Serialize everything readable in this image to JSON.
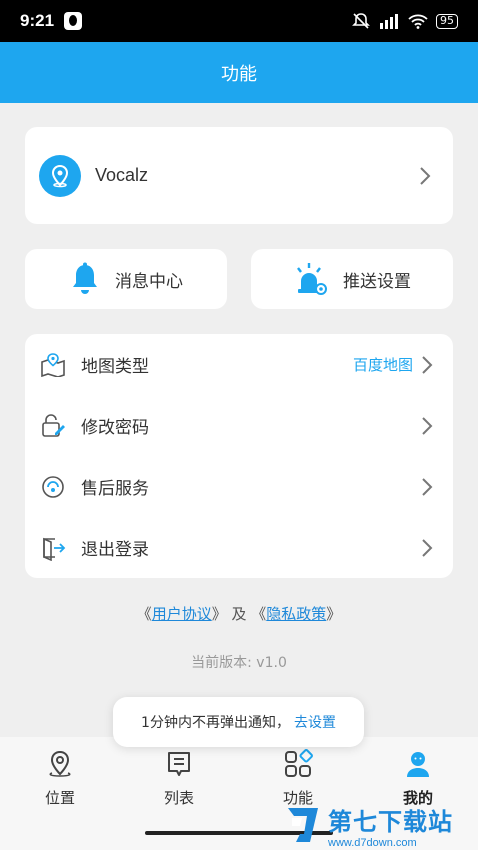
{
  "status_bar": {
    "time": "9:21",
    "battery": "95"
  },
  "header": {
    "title": "功能"
  },
  "user": {
    "name": "Vocalz"
  },
  "quick_actions": [
    {
      "label": "消息中心",
      "icon": "bell-icon"
    },
    {
      "label": "推送设置",
      "icon": "alarm-settings-icon"
    }
  ],
  "menu": [
    {
      "label": "地图类型",
      "value": "百度地图",
      "icon": "map-icon"
    },
    {
      "label": "修改密码",
      "icon": "edit-password-icon"
    },
    {
      "label": "售后服务",
      "icon": "service-icon"
    },
    {
      "label": "退出登录",
      "icon": "logout-icon"
    }
  ],
  "agreements": {
    "open1": "《",
    "user_agreement": "用户协议",
    "close1": "》",
    "and": " 及 ",
    "open2": "《",
    "privacy_policy": "隐私政策",
    "close2": "》"
  },
  "version": "当前版本: v1.0",
  "toast": {
    "text": "1分钟内不再弹出通知，",
    "action": "去设置"
  },
  "tabs": [
    {
      "label": "位置",
      "icon": "location-icon"
    },
    {
      "label": "列表",
      "icon": "list-icon"
    },
    {
      "label": "功能",
      "icon": "grid-icon"
    },
    {
      "label": "我的",
      "icon": "person-icon",
      "active": true
    }
  ],
  "watermark": {
    "title": "第七下载站",
    "url": "www.d7down.com"
  },
  "colors": {
    "accent": "#1ea6ef",
    "link": "#1e88d9",
    "background": "#efefef"
  }
}
